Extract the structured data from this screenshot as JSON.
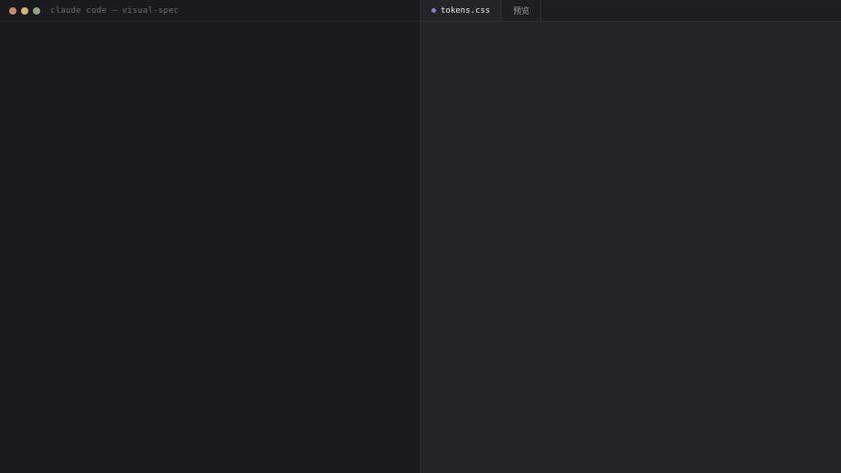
{
  "window": {
    "title": "claude code — visual-spec",
    "controls": {
      "close_color": "#c98a6e",
      "minimize_color": "#d4b278",
      "maximize_color": "#8fa47c"
    }
  },
  "editor": {
    "tabs": [
      {
        "label": "tokens.css",
        "active": true,
        "modified_dot_color": "#8b7bd8"
      },
      {
        "label": "预览",
        "active": false
      }
    ]
  }
}
